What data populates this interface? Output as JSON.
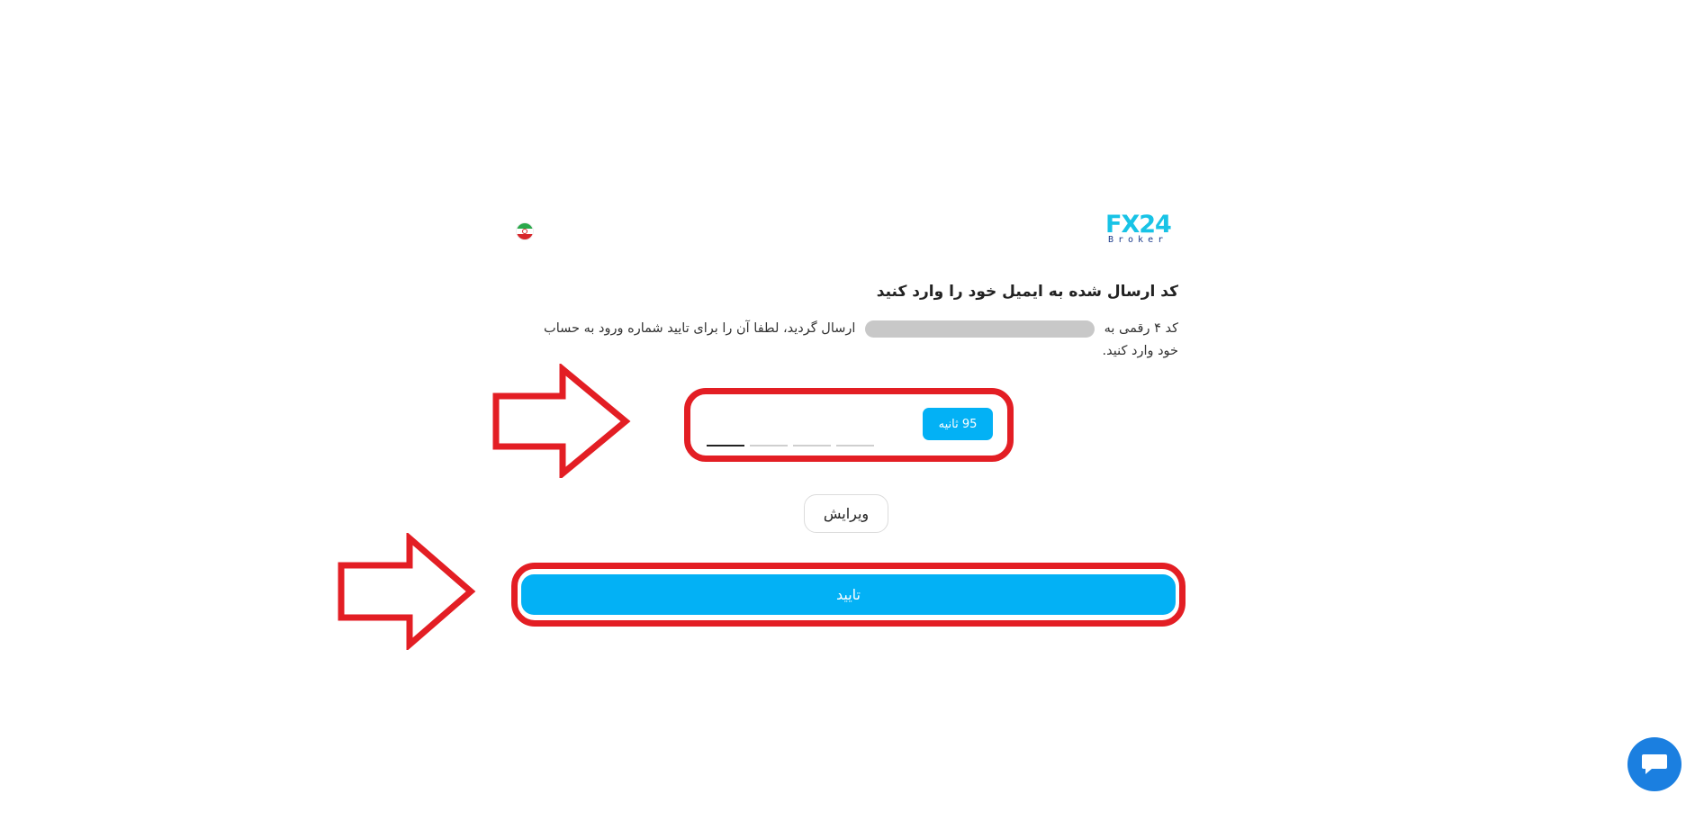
{
  "brand": {
    "logo_main": "FX24",
    "logo_sub": "Broker"
  },
  "language": {
    "current": "fa",
    "flag_icon": "iran-flag-icon"
  },
  "verify": {
    "title": "کد ارسال شده به ایمیل خود را وارد کنید",
    "desc_before": "کد ۴ رقمی به",
    "desc_after": "ارسال گردید، لطفا آن را برای تایید شماره ورود به حساب خود وارد کنید.",
    "email_masked": "",
    "otp": {
      "length": 4,
      "values": [
        "",
        "",
        "",
        ""
      ]
    },
    "timer_label": "95 ثانیه",
    "edit_label": "ویرایش",
    "confirm_label": "تایید"
  },
  "colors": {
    "accent": "#03b1f5",
    "highlight": "#e31e24",
    "chat": "#1b7fe0"
  },
  "support": {
    "chat_icon": "chat-bubble-icon"
  }
}
